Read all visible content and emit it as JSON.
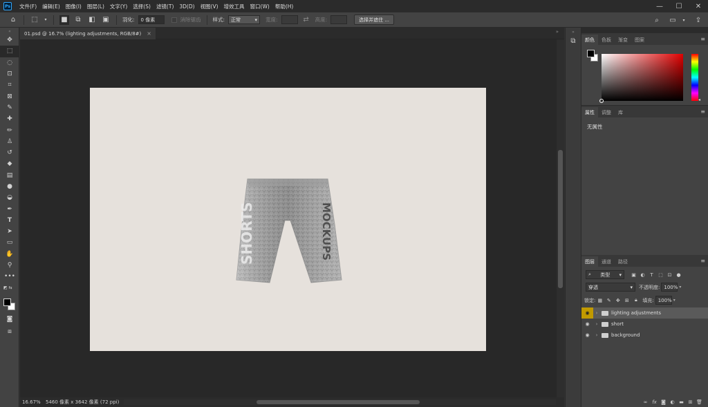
{
  "app": {
    "logo": "Ps",
    "menu": [
      "文件(F)",
      "编辑(E)",
      "图像(I)",
      "图层(L)",
      "文字(Y)",
      "选择(S)",
      "滤镜(T)",
      "3D(D)",
      "视图(V)",
      "增效工具",
      "窗口(W)",
      "帮助(H)"
    ],
    "window_controls": {
      "minimize": "—",
      "maximize": "☐",
      "close": "✕"
    }
  },
  "options": {
    "feather_label": "羽化:",
    "feather_value": "0 像素",
    "antialias_label": "消除锯齿",
    "style_label": "样式:",
    "style_value": "正常",
    "width_label": "宽度:",
    "height_label": "高度:",
    "select_mask_button": "选择并遮住 ..."
  },
  "document": {
    "tab_title": "01.psd @ 16.7% (lighting adjustments, RGB/8#)",
    "close": "×",
    "zoom": "16.67%",
    "dimensions": "5460 像素 x 3642 像素 (72 ppi)",
    "canvas_color": "#e6e1dc",
    "mockup_text_left": "SHORTS",
    "mockup_text_right": "MOCKUPS"
  },
  "color_panel": {
    "tabs": [
      "颜色",
      "色板",
      "渐变",
      "图案"
    ],
    "active_tab": 0,
    "foreground": "#000000",
    "background": "#ffffff",
    "hue_color": "#e10000"
  },
  "properties_panel": {
    "tabs": [
      "属性",
      "调整",
      "库"
    ],
    "active_tab": 0,
    "content": "无属性"
  },
  "layers_panel": {
    "tabs": [
      "图层",
      "通道",
      "路径"
    ],
    "active_tab": 0,
    "filter_type": "类型",
    "blend_mode": "穿透",
    "opacity_label": "不透明度:",
    "opacity_value": "100%",
    "lock_label": "锁定:",
    "fill_label": "填充:",
    "fill_value": "100%",
    "layers": [
      {
        "name": "lighting adjustments",
        "selected": true
      },
      {
        "name": "short",
        "selected": false
      },
      {
        "name": "background",
        "selected": false
      }
    ]
  },
  "colors": {
    "panel_bg": "#434343",
    "app_bg": "#282828",
    "selection_eye": "#c19a00"
  }
}
